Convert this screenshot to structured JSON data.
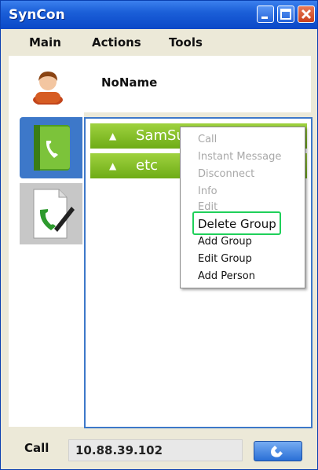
{
  "window": {
    "title": "SynCon"
  },
  "menu": {
    "items": [
      "Main",
      "Actions",
      "Tools"
    ]
  },
  "user": {
    "name": "NoName"
  },
  "groups": [
    {
      "name": "SamSu"
    },
    {
      "name": "etc"
    }
  ],
  "context_menu": {
    "items": [
      {
        "label": "Call",
        "enabled": false
      },
      {
        "label": "Instant Message",
        "enabled": false
      },
      {
        "label": "Disconnect",
        "enabled": false
      },
      {
        "label": "Info",
        "enabled": false
      },
      {
        "label": "Edit",
        "enabled": false
      },
      {
        "label": "Delete Group",
        "enabled": true,
        "highlighted": true
      },
      {
        "label": "Add Group",
        "enabled": true
      },
      {
        "label": "Edit Group",
        "enabled": true
      },
      {
        "label": "Add Person",
        "enabled": true
      }
    ]
  },
  "call": {
    "label": "Call",
    "address": "10.88.39.102"
  },
  "icons": {
    "minimize": "minimize-icon",
    "maximize": "maximize-icon",
    "close": "close-icon",
    "avatar": "user-avatar-icon",
    "contacts_tab": "phone-book-icon",
    "call_log_tab": "phone-document-icon",
    "call_button": "phone-handset-icon"
  },
  "colors": {
    "titlebar": "#0a48c7",
    "group_bg": "#7fbf1e",
    "highlight": "#1fd05a",
    "panel_border": "#3d78c9"
  }
}
